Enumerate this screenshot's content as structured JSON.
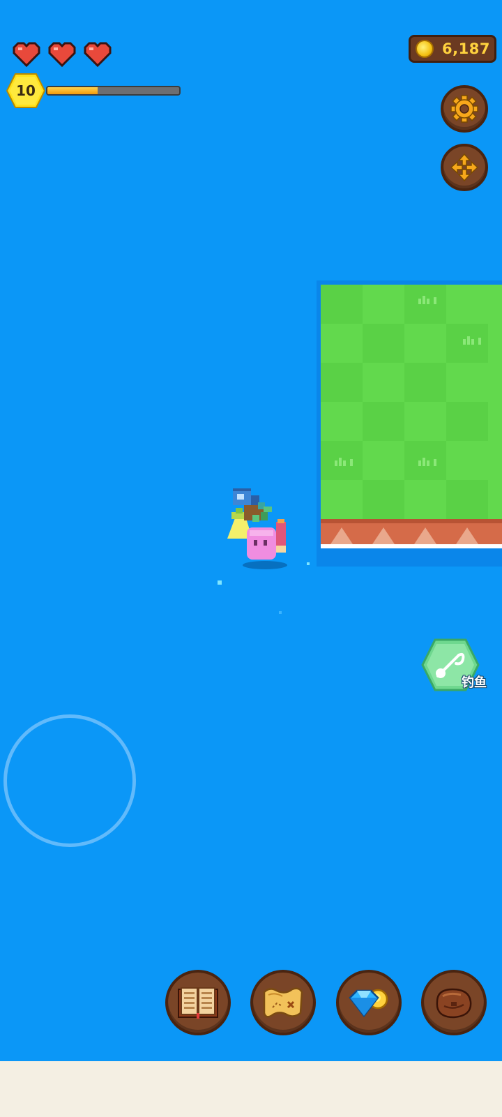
{
  "hud": {
    "hearts": [
      {
        "name": "heart-icon",
        "filled": true
      },
      {
        "name": "heart-icon",
        "filled": true
      },
      {
        "name": "heart-icon",
        "filled": true
      }
    ],
    "level": "10",
    "xp_progress": 0.38,
    "coins": "6,187"
  },
  "controls": {
    "settings_icon": "gear-icon",
    "move_icon": "move-arrows-icon"
  },
  "actions": {
    "fishing_label": "钓鱼",
    "fishing_icon": "fishing-rod-icon"
  },
  "bottom_menu": [
    {
      "name": "book-icon"
    },
    {
      "name": "treasure-map-icon"
    },
    {
      "name": "gem-shop-icon"
    },
    {
      "name": "bag-icon"
    }
  ],
  "colors": {
    "water": "#0b97f7",
    "grass": "#62d94d",
    "grass_dark": "#57cc44",
    "cliff": "#d56b49",
    "hud_wood": "#7a4527",
    "coin_text": "#ffd23e",
    "xp_fill": "#f29a0b",
    "level_hex": "#ffe11a"
  }
}
